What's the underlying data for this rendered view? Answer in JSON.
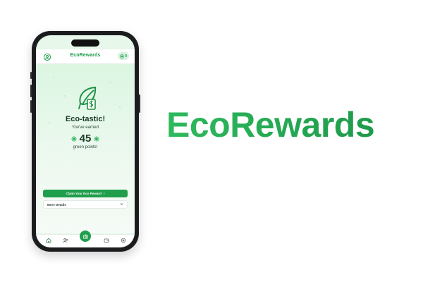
{
  "app": {
    "title": "EcoRewards",
    "points_chip_value": "0"
  },
  "reward": {
    "headline": "Eco-tastic!",
    "earned_label": "You've earned",
    "points": "45",
    "points_label": "green points!"
  },
  "actions": {
    "claim_label": "Claim Your Eco Reward",
    "claim_chevron": "›",
    "details_label": "More Details"
  },
  "bottom_nav": {
    "items": [
      "home-icon",
      "people-icon",
      "eco-scan-icon",
      "wallet-icon",
      "settings-icon"
    ]
  },
  "brand": {
    "wordmark": "EcoRewards"
  },
  "colors": {
    "accent": "#1f9e4b",
    "accent_light": "#2dba5d",
    "background_tint": "#dcf6e2",
    "text_dark": "#1a3a25"
  }
}
